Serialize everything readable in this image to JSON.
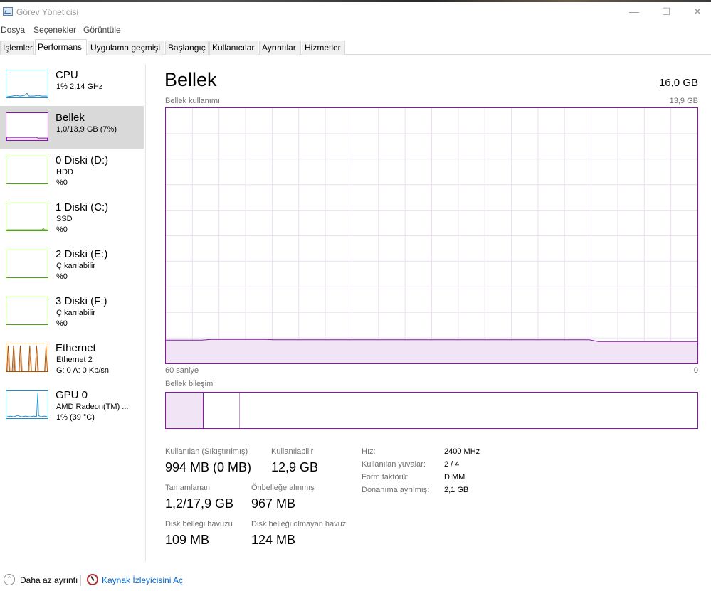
{
  "window": {
    "title": "Görev Yöneticisi",
    "minimize": "—",
    "maximize": "☐",
    "close": "✕"
  },
  "menu": [
    "Dosya",
    "Seçenekler",
    "Görüntüle"
  ],
  "tabs": [
    "İşlemler",
    "Performans",
    "Uygulama geçmişi",
    "Başlangıç",
    "Kullanıcılar",
    "Ayrıntılar",
    "Hizmetler"
  ],
  "active_tab": "Performans",
  "colors": {
    "cpu": "#1a8fd0",
    "memory": "#8b12ae",
    "disk": "#4da60c",
    "ethernet": "#a74f01",
    "gpu": "#1a8fd0"
  },
  "sidebar": {
    "items": [
      {
        "name": "CPU",
        "line1": "1% 2,14 GHz",
        "line2": ""
      },
      {
        "name": "Bellek",
        "line1": "1,0/13,9 GB (7%)",
        "line2": ""
      },
      {
        "name": "0 Diski (D:)",
        "line1": "HDD",
        "line2": "%0"
      },
      {
        "name": "1 Diski (C:)",
        "line1": "SSD",
        "line2": "%0"
      },
      {
        "name": "2 Diski (E:)",
        "line1": "Çıkarılabilir",
        "line2": "%0"
      },
      {
        "name": "3 Diski (F:)",
        "line1": "Çıkarılabilir",
        "line2": "%0"
      },
      {
        "name": "Ethernet",
        "line1": "Ethernet 2",
        "line2": "G: 0 A: 0 Kb/sn"
      },
      {
        "name": "GPU 0",
        "line1": "AMD Radeon(TM) ...",
        "line2": "1% (39 °C)"
      }
    ]
  },
  "main": {
    "title": "Bellek",
    "total": "16,0 GB",
    "usage_label": "Bellek kullanımı",
    "usage_max": "13,9 GB",
    "time_left": "60 saniye",
    "time_right": "0",
    "composition_label": "Bellek bileşimi",
    "usage_series": [
      0.075,
      0.075,
      0.075,
      0.075,
      0.075,
      0.077,
      0.077,
      0.077,
      0.077,
      0.077,
      0.077,
      0.077,
      0.076,
      0.076,
      0.076,
      0.076,
      0.076,
      0.076,
      0.076,
      0.076,
      0.076,
      0.076,
      0.076,
      0.076,
      0.076,
      0.076,
      0.076,
      0.076,
      0.076,
      0.076,
      0.076,
      0.076,
      0.076,
      0.076,
      0.076,
      0.076,
      0.076,
      0.076,
      0.076,
      0.076,
      0.076,
      0.076,
      0.076,
      0.076,
      0.076,
      0.076,
      0.076,
      0.076,
      0.07,
      0.07,
      0.07,
      0.07,
      0.07,
      0.07,
      0.07,
      0.07,
      0.07,
      0.07,
      0.07,
      0.07
    ]
  },
  "stats": {
    "in_use_label": "Kullanılan (Sıkıştırılmış)",
    "in_use_value": "994 MB (0 MB)",
    "available_label": "Kullanılabilir",
    "available_value": "12,9 GB",
    "committed_label": "Tamamlanan",
    "committed_value": "1,2/17,9 GB",
    "cached_label": "Önbelleğe alınmış",
    "cached_value": "967 MB",
    "paged_label": "Disk belleği havuzu",
    "paged_value": "109 MB",
    "nonpaged_label": "Disk belleği olmayan havuz",
    "nonpaged_value": "124 MB"
  },
  "info": [
    {
      "label": "Hız:",
      "value": "2400 MHz"
    },
    {
      "label": "Kullanılan yuvalar:",
      "value": "2 / 4"
    },
    {
      "label": "Form faktörü:",
      "value": "DIMM"
    },
    {
      "label": "Donanıma ayrılmış:",
      "value": "2,1 GB"
    }
  ],
  "footer": {
    "fewer_details": "Daha az ayrıntı",
    "resource_monitor": "Kaynak İzleyicisini Aç"
  }
}
